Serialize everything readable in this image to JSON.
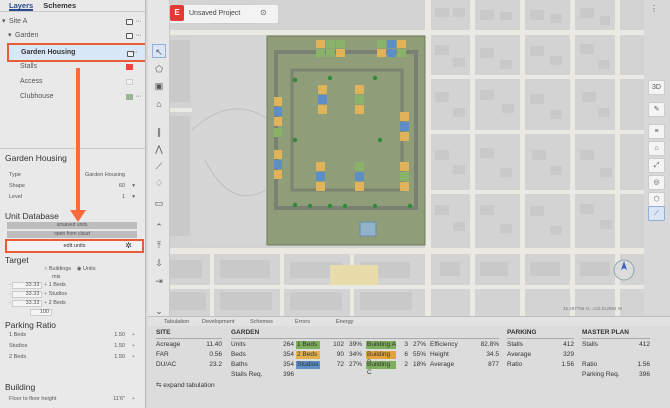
{
  "left_panel": {
    "tabs": [
      "Layers",
      "Schemes"
    ],
    "tree": {
      "site": "Site A",
      "garden": "Garden",
      "garden_housing": "Garden Housing",
      "stalls": "Stalls",
      "access": "Access",
      "clubhouse": "Clubhouse",
      "more": "···",
      "colors": {
        "stalls": "#e5483d",
        "access": "#f0f0f0",
        "clubhouse": "#9fb29a"
      }
    },
    "properties": {
      "title": "Garden Housing",
      "rows": [
        {
          "label": "Type",
          "value": "Garden Housing"
        },
        {
          "label": "Shape",
          "value": "60"
        },
        {
          "label": "Level",
          "value": "1"
        }
      ]
    },
    "unit_database": {
      "title": "Unit Database",
      "bar1": "unsaved units",
      "bar2": "open from cloud",
      "edit_units": "edit units",
      "gear": "✲"
    },
    "target": {
      "title": "Target",
      "radio_buildings": "Buildings",
      "radio_units": "Units",
      "mix_label": "mix",
      "mix": [
        {
          "value": "33.33",
          "label": "1 Beds"
        },
        {
          "value": "33.33",
          "label": "Studios"
        },
        {
          "value": "33.33",
          "label": "2 Beds"
        }
      ],
      "total": "100"
    },
    "parking_ratio": {
      "title": "Parking Ratio",
      "rows": [
        {
          "label": "1 Beds",
          "value": "1.50"
        },
        {
          "label": "Studios",
          "value": "1.50"
        },
        {
          "label": "2 Beds",
          "value": "1.50"
        }
      ]
    },
    "building": {
      "title": "Building",
      "floor_label": "Floor to floor height",
      "floor_value": "11'6\""
    }
  },
  "topbar": {
    "logo": "E",
    "project": "Unsaved Project",
    "camera_icon": "camera-icon"
  },
  "map": {
    "buttons": [
      "3D",
      "✎",
      "≡",
      "⌂",
      "⤢",
      "◎",
      "⬡",
      "⟋"
    ],
    "coords": "45.497796 N, -122.612854 W",
    "colors": {
      "site": "#8f9e78",
      "building_orange": "#e0b25a",
      "building_green": "#8ab36a",
      "building_blue": "#5d8ec8",
      "road": "#ebe9e4"
    }
  },
  "bottom_tabs": [
    "Tabulation",
    "Development",
    "Schemes",
    "Errors",
    "Energy"
  ],
  "tabulation": {
    "site": {
      "title": "SITE",
      "rows": [
        [
          "Acreage",
          "11.40"
        ],
        [
          "FAR",
          "0.56"
        ],
        [
          "DU/AC",
          "23.2"
        ]
      ]
    },
    "garden": {
      "title": "GARDEN",
      "rows": [
        {
          "label": "Units",
          "value": "264",
          "unit": "1 Beds",
          "count": "102",
          "pct": "39%",
          "bldg": "Building A",
          "bnum": "3",
          "bpct": "27%",
          "metric": "Efficiency",
          "mval": "82.8%"
        },
        {
          "label": "Beds",
          "value": "354",
          "unit": "2 Beds",
          "count": "90",
          "pct": "34%",
          "bldg": "Building B",
          "bnum": "6",
          "bpct": "55%",
          "metric": "Height",
          "mval": "34.5"
        },
        {
          "label": "Baths",
          "value": "354",
          "unit": "Studios",
          "count": "72",
          "pct": "27%",
          "bldg": "Building C",
          "bnum": "2",
          "bpct": "18%",
          "metric": "Average",
          "mval": "877"
        }
      ],
      "stalls_req_label": "Stalls Req.",
      "stalls_req": "396",
      "chip_colors": {
        "1 Beds": "#7cae5c",
        "2 Beds": "#e2b04c",
        "Studios": "#5b8fc6",
        "Building A": "#7cae5c",
        "Building B": "#e2a23c",
        "Building C": "#7cae5c"
      }
    },
    "parking": {
      "title": "PARKING",
      "rows": [
        [
          "Stalls",
          "412"
        ],
        [
          "Average",
          "329"
        ],
        [
          "Ratio",
          "1.56"
        ]
      ]
    },
    "master_plan": {
      "title": "MASTER PLAN",
      "rows": [
        [
          "Stalls",
          "412"
        ],
        [
          "Ratio",
          "1.56"
        ],
        [
          "Parking Req.",
          "396"
        ]
      ]
    },
    "expand": "expand tabulation"
  }
}
